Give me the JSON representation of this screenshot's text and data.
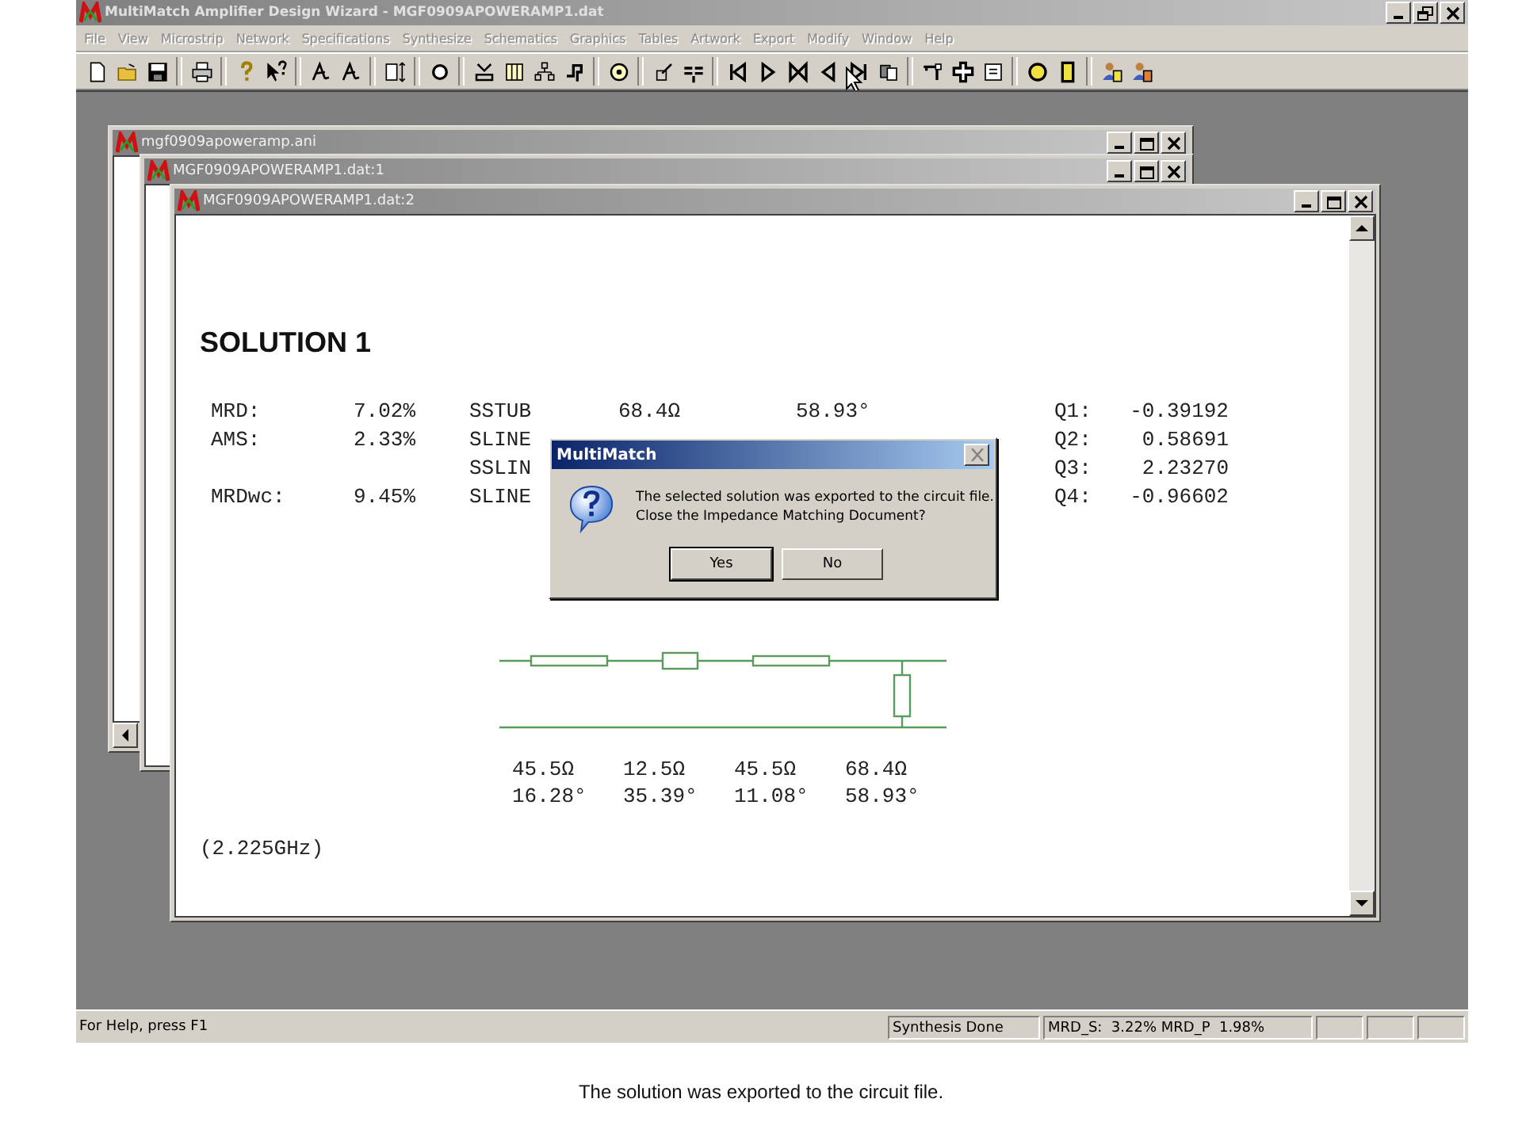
{
  "app": {
    "title": "MultiMatch Amplifier Design Wizard - MGF0909APOWERAMP1.dat",
    "active": false
  },
  "menu": [
    {
      "label": "File",
      "disabled": true
    },
    {
      "label": "View",
      "disabled": true
    },
    {
      "label": "Microstrip",
      "disabled": true
    },
    {
      "label": "Network",
      "disabled": true
    },
    {
      "label": "Specifications",
      "disabled": true
    },
    {
      "label": "Synthesize",
      "disabled": true
    },
    {
      "label": "Schematics",
      "disabled": true
    },
    {
      "label": "Graphics",
      "disabled": true
    },
    {
      "label": "Tables",
      "disabled": true
    },
    {
      "label": "Artwork",
      "disabled": true
    },
    {
      "label": "Export",
      "disabled": true
    },
    {
      "label": "Modify",
      "disabled": true
    },
    {
      "label": "Window",
      "disabled": true
    },
    {
      "label": "Help",
      "disabled": true
    }
  ],
  "documents": [
    {
      "title": "mgf0909apoweramp.ani"
    },
    {
      "title": "MGF0909APOWERAMP1.dat:1"
    },
    {
      "title": "MGF0909APOWERAMP1.dat:2"
    }
  ],
  "report": {
    "heading": "SOLUTION 1",
    "rows": [
      {
        "metric": "MRD:",
        "metric_value": "7.02%",
        "element": "SSTUB",
        "impedance": "68.4Ω",
        "angle": "58.93°",
        "q": "Q1:",
        "q_value": "-0.39192"
      },
      {
        "metric": "AMS:",
        "metric_value": "2.33%",
        "element": "SLINE",
        "q": "Q2:",
        "q_value": "0.58691"
      },
      {
        "element": "SSLIN",
        "q": "Q3:",
        "q_value": "2.23270"
      },
      {
        "metric": "MRDwc:",
        "metric_value": "9.45%",
        "element": "SLINE",
        "q": "Q4:",
        "q_value": "-0.96602"
      }
    ],
    "sections": [
      {
        "kind": "series",
        "impedance": "45.5Ω",
        "angle": "16.28°"
      },
      {
        "kind": "series",
        "impedance": "12.5Ω",
        "angle": "35.39°"
      },
      {
        "kind": "series",
        "impedance": "45.5Ω",
        "angle": "11.08°"
      },
      {
        "kind": "stub",
        "impedance": "68.4Ω",
        "angle": "58.93°"
      }
    ],
    "frequency": "(2.225GHz)"
  },
  "dialog": {
    "title": "MultiMatch",
    "message": "The selected solution was exported to the circuit file.\nClose the Impedance Matching Document?",
    "buttons": [
      {
        "label": "Yes",
        "default": true
      },
      {
        "label": "No",
        "default": false
      }
    ]
  },
  "status_bar": {
    "help": "For Help, press F1",
    "panes": [
      "Synthesis Done",
      "MRD_S:  3.22% MRD_P  1.98%"
    ]
  },
  "caption": "The solution was exported to the circuit file."
}
